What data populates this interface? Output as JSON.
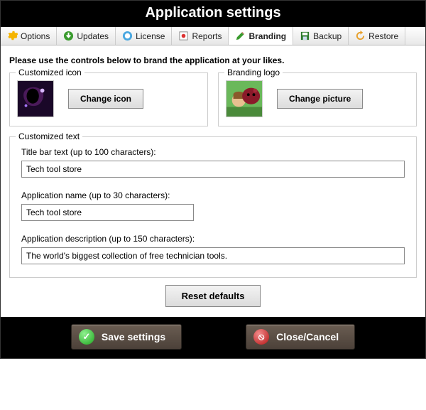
{
  "title": "Application settings",
  "tabs": {
    "options": "Options",
    "updates": "Updates",
    "license": "License",
    "reports": "Reports",
    "branding": "Branding",
    "backup": "Backup",
    "restore": "Restore"
  },
  "intro": "Please use the controls below to brand the application at your likes.",
  "iconSection": {
    "legend": "Customized icon",
    "button": "Change icon"
  },
  "logoSection": {
    "legend": "Branding logo",
    "button": "Change picture"
  },
  "textSection": {
    "legend": "Customized text",
    "titlebar": {
      "label": "Title bar text (up to 100 characters):",
      "value": "Tech tool store"
    },
    "appname": {
      "label": "Application name (up to 30 characters):",
      "value": "Tech tool store"
    },
    "appdesc": {
      "label": "Application description (up to 150 characters):",
      "value": "The world's biggest collection of free technician tools."
    }
  },
  "reset": "Reset defaults",
  "footer": {
    "save": "Save settings",
    "cancel": "Close/Cancel"
  }
}
